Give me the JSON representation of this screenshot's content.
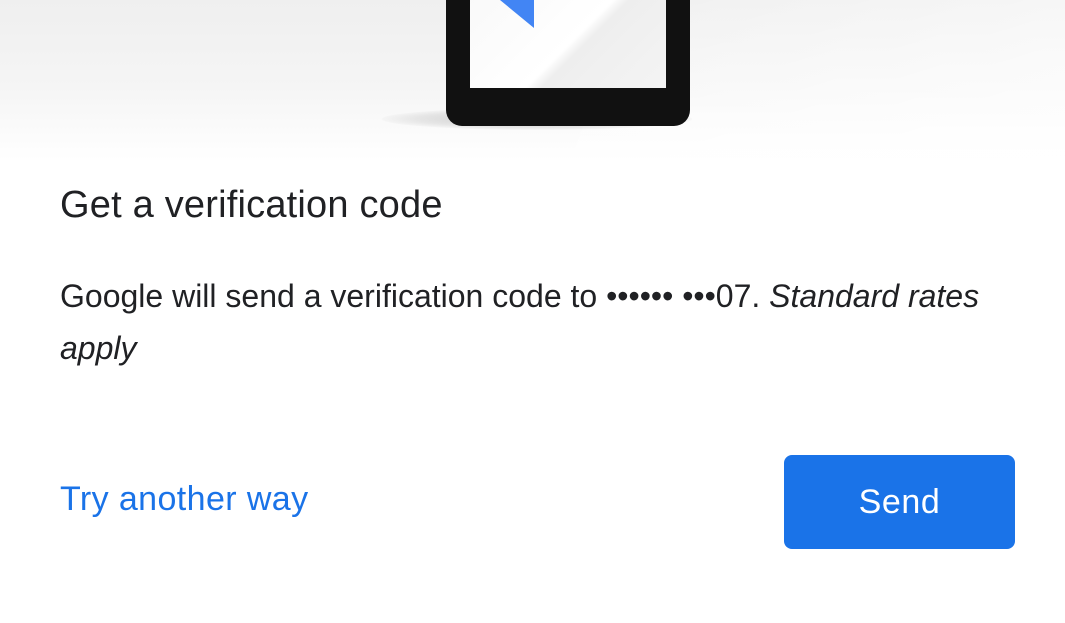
{
  "header": {
    "illustration_icon": "phone-message-illustration",
    "accent_color": "#4285f4"
  },
  "main": {
    "title": "Get a verification code",
    "message": "Google will send a verification code to •••••• •••07.",
    "message_emphasis": "Standard rates apply"
  },
  "actions": {
    "try_another_way_label": "Try another way",
    "send_label": "Send",
    "primary_color": "#1a73e8"
  }
}
